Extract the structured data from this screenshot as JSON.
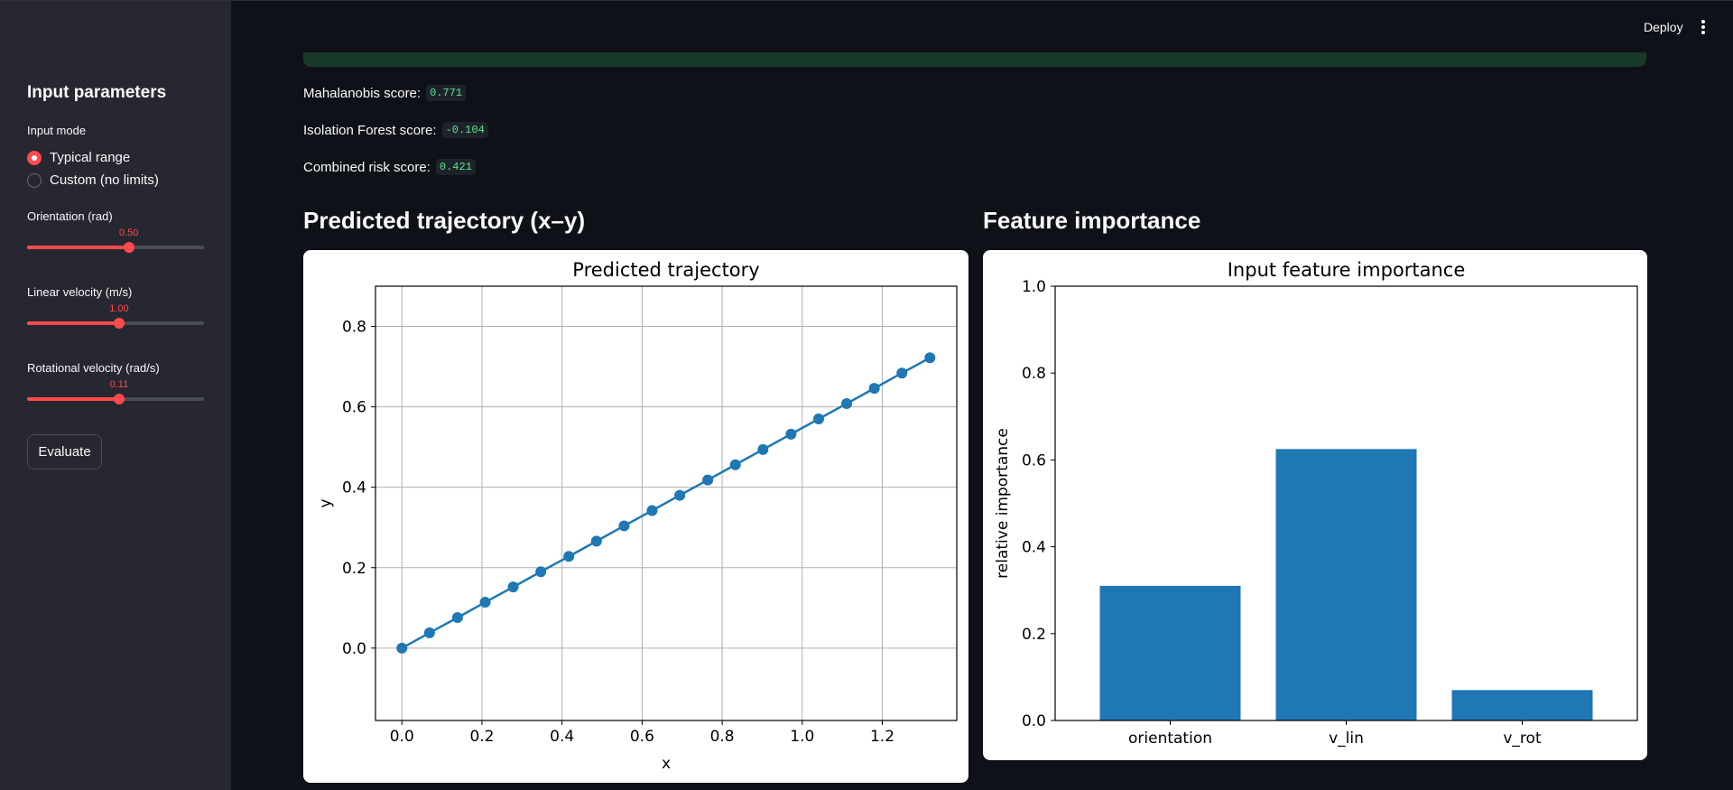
{
  "header": {
    "deploy_label": "Deploy",
    "menu_icon": "vertical-ellipsis-icon"
  },
  "sidebar": {
    "title": "Input parameters",
    "input_mode": {
      "label": "Input mode",
      "options": [
        {
          "label": "Typical range",
          "selected": true
        },
        {
          "label": "Custom (no limits)",
          "selected": false
        }
      ]
    },
    "sliders": [
      {
        "label": "Orientation (rad)",
        "value": "0.50",
        "fraction": 0.575
      },
      {
        "label": "Linear velocity (m/s)",
        "value": "1.00",
        "fraction": 0.52
      },
      {
        "label": "Rotational velocity (rad/s)",
        "value": "0.11",
        "fraction": 0.52
      }
    ],
    "evaluate_label": "Evaluate"
  },
  "main": {
    "scores": [
      {
        "label": "Mahalanobis score:",
        "value": "0.771"
      },
      {
        "label": "Isolation Forest score:",
        "value": "-0.104"
      },
      {
        "label": "Combined risk score:",
        "value": "0.421"
      }
    ],
    "trajectory_heading": "Predicted trajectory (x–y)",
    "importance_heading": "Feature importance"
  },
  "chart_data": [
    {
      "type": "line",
      "title": "Predicted trajectory",
      "xlabel": "x",
      "ylabel": "y",
      "xlim": [
        -0.066,
        1.386
      ],
      "ylim": [
        -0.18,
        0.9
      ],
      "xticks": [
        "0.0",
        "0.2",
        "0.4",
        "0.6",
        "0.8",
        "1.0",
        "1.2"
      ],
      "yticks": [
        "0.0",
        "0.2",
        "0.4",
        "0.6",
        "0.8"
      ],
      "grid": true,
      "color": "#1f77b4",
      "x": [
        0.0,
        0.069,
        0.139,
        0.208,
        0.278,
        0.347,
        0.417,
        0.486,
        0.555,
        0.625,
        0.694,
        0.764,
        0.833,
        0.902,
        0.972,
        1.041,
        1.111,
        1.18,
        1.249,
        1.319
      ],
      "y": [
        0.0,
        0.038,
        0.076,
        0.114,
        0.152,
        0.19,
        0.228,
        0.266,
        0.304,
        0.342,
        0.38,
        0.418,
        0.456,
        0.494,
        0.532,
        0.57,
        0.608,
        0.646,
        0.684,
        0.722
      ]
    },
    {
      "type": "bar",
      "title": "Input feature importance",
      "xlabel": "",
      "ylabel": "relative importance",
      "ylim": [
        0,
        1.0
      ],
      "yticks": [
        "0.0",
        "0.2",
        "0.4",
        "0.6",
        "0.8",
        "1.0"
      ],
      "categories": [
        "orientation",
        "v_lin",
        "v_rot"
      ],
      "values": [
        0.31,
        0.625,
        0.07
      ],
      "color": "#1f77b4",
      "grid": false
    }
  ]
}
